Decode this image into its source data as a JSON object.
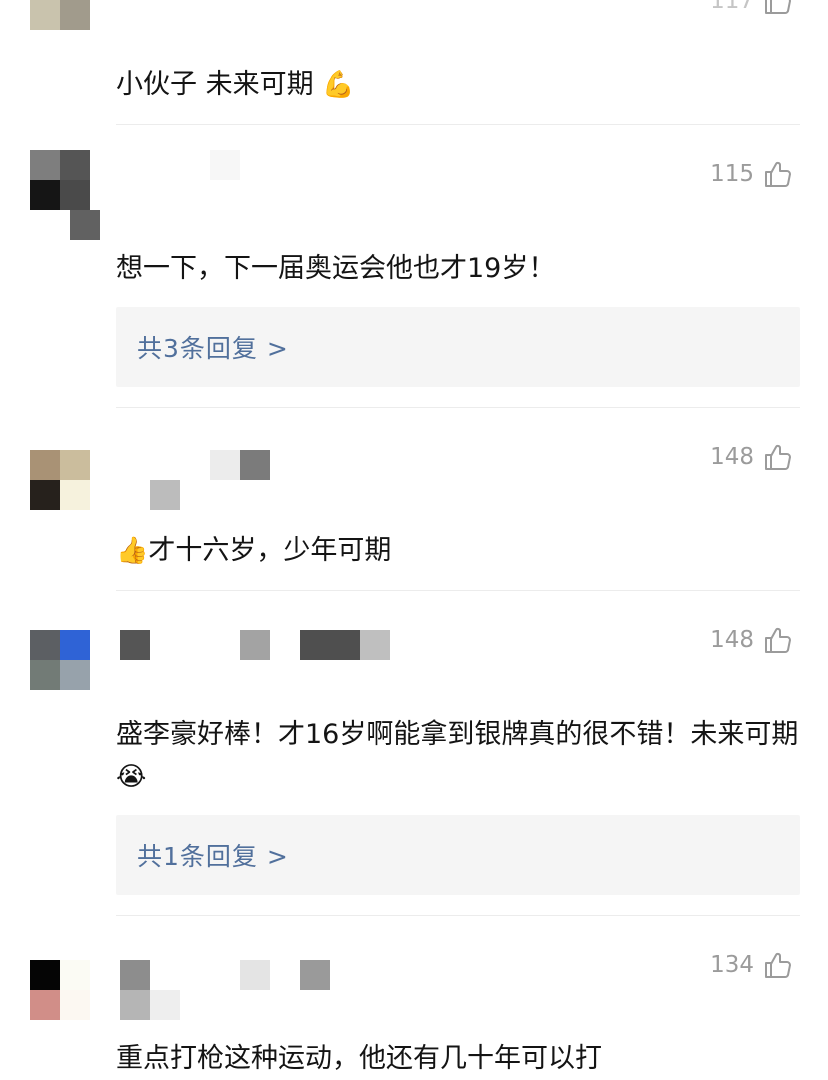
{
  "comments": [
    {
      "likes": "",
      "text": "小伙子 未来可期",
      "emoji": "💪",
      "replies": ""
    },
    {
      "likes": "115",
      "text": "想一下，下一届奥运会他也才19岁！",
      "emoji": "",
      "replies": "共3条回复 >"
    },
    {
      "likes": "148",
      "text": "才十六岁，少年可期",
      "emoji_prefix": "👍",
      "replies": ""
    },
    {
      "likes": "148",
      "text": "盛李豪好棒！才16岁啊能拿到银牌真的很不错！未来可期",
      "emoji": "😭",
      "replies": "共1条回复 >"
    },
    {
      "likes": "134",
      "text": "重点打枪这种运动，他还有几十年可以打",
      "emoji": "",
      "replies": ""
    }
  ],
  "icons": {
    "like": "thumbs-up-icon",
    "flex": "flexed-biceps-emoji",
    "thumb_emoji": "thumbs-up-emoji",
    "cry_emoji": "crying-face-emoji"
  },
  "colors": {
    "reply_link": "#51709c",
    "likes_text": "#9b9b9b",
    "reply_bg": "#f5f5f5"
  }
}
